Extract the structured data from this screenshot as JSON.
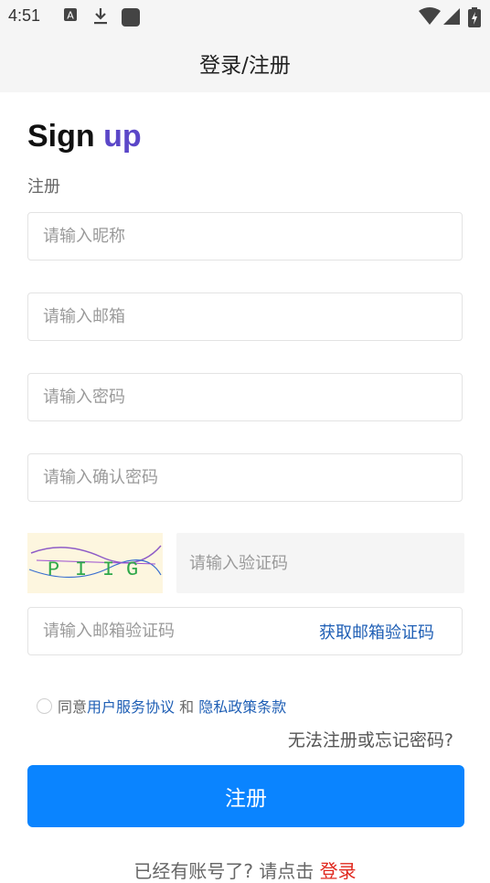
{
  "status_bar": {
    "time": "4:51",
    "icons": [
      "a-notification-icon",
      "download-icon",
      "square-notification-icon",
      "wifi-icon",
      "cell-signal-icon",
      "battery-icon"
    ]
  },
  "app_bar": {
    "title": "登录/注册"
  },
  "heading": {
    "word1": "Sign",
    "word2": "up"
  },
  "subheading": "注册",
  "fields": {
    "nickname_placeholder": "请输入昵称",
    "email_placeholder": "请输入邮箱",
    "password_placeholder": "请输入密码",
    "confirm_password_placeholder": "请输入确认密码",
    "captcha_placeholder": "请输入验证码",
    "email_code_placeholder": "请输入邮箱验证码"
  },
  "captcha": {
    "chars": [
      "P",
      "I",
      "I",
      "G"
    ]
  },
  "email_code_button": "获取邮箱验证码",
  "agreement": {
    "prefix": "同意",
    "terms_link": "用户服务协议",
    "and": " 和 ",
    "privacy_link": "隐私政策条款"
  },
  "forgot_link": "无法注册或忘记密码?",
  "submit_label": "注册",
  "footer": {
    "text": "已经有账号了? 请点击 ",
    "login_link": "登录"
  },
  "colors": {
    "accent_purple": "#5b47c8",
    "primary_button": "#0a84ff",
    "link_blue": "#1f5fb5",
    "login_red": "#e0281e"
  }
}
